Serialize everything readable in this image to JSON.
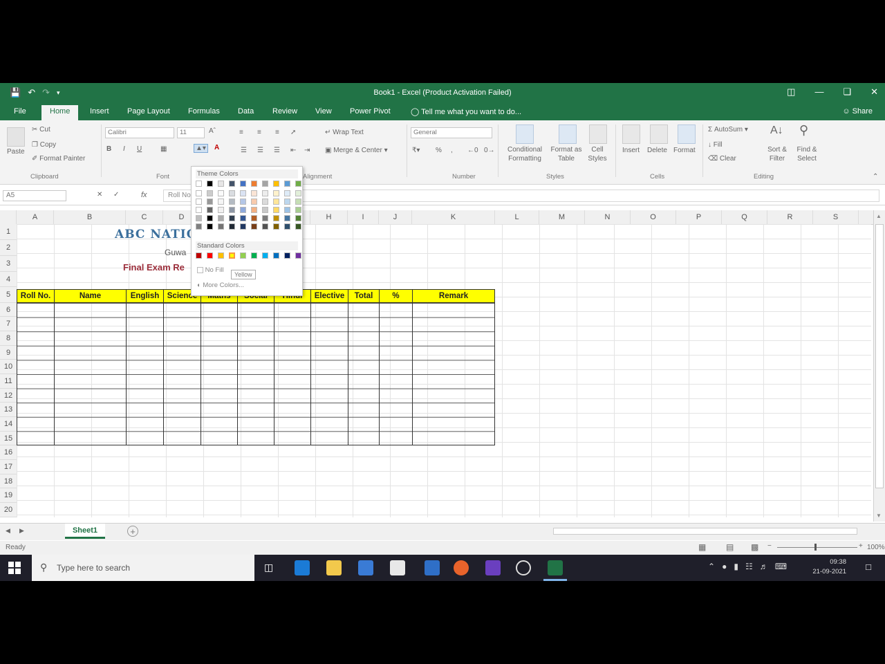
{
  "window": {
    "title": "Book1 - Excel (Product Activation Failed)",
    "share_label": "Share",
    "minimize_icon": "minimize-icon",
    "restore_icon": "restore-icon",
    "close_icon": "close-icon"
  },
  "ribbon_tabs": [
    "File",
    "Home",
    "Insert",
    "Page Layout",
    "Formulas",
    "Data",
    "Review",
    "View",
    "Power Pivot"
  ],
  "tell_me": "Tell me what you want to do...",
  "clipboard": {
    "paste": "Paste",
    "cut": "Cut",
    "copy": "Copy",
    "format_painter": "Format Painter",
    "label": "Clipboard"
  },
  "font": {
    "name": "Calibri",
    "size": "11",
    "label": "Font"
  },
  "alignment": {
    "wrap_text": "Wrap Text",
    "merge_center": "Merge & Center",
    "label": "Alignment"
  },
  "number": {
    "format": "General",
    "label": "Number"
  },
  "styles": {
    "conditional": "Conditional Formatting",
    "format_table": "Format as Table",
    "cell_styles": "Cell Styles",
    "label": "Styles"
  },
  "cells": {
    "insert": "Insert",
    "delete": "Delete",
    "format": "Format",
    "label": "Cells"
  },
  "editing": {
    "autosum": "AutoSum",
    "fill": "Fill",
    "clear": "Clear",
    "sort_filter": "Sort & Filter",
    "find_select": "Find & Select",
    "label": "Editing"
  },
  "formula_bar": {
    "name_box": "A5",
    "fx": "fx",
    "content": "Roll No."
  },
  "columns": [
    "A",
    "B",
    "C",
    "D",
    "E",
    "F",
    "G",
    "H",
    "I",
    "J",
    "K",
    "L",
    "M",
    "N",
    "O",
    "P",
    "Q",
    "R",
    "S"
  ],
  "rows": [
    "1",
    "2",
    "3",
    "4",
    "5",
    "6",
    "7",
    "8",
    "9",
    "10",
    "11",
    "12",
    "13",
    "14",
    "15",
    "16",
    "17",
    "18",
    "19",
    "20"
  ],
  "sheet_content": {
    "title": "ABC NATIO",
    "subtitle": "Guwa",
    "exam_title": "Final Exam Re"
  },
  "table_headers": [
    "Roll No.",
    "Name",
    "English",
    "Science",
    "Maths",
    "Social",
    "Hindi",
    "Elective",
    "Total",
    "%",
    "Remark"
  ],
  "color_menu": {
    "theme_label": "Theme Colors",
    "standard_label": "Standard Colors",
    "no_fill": "No Fill",
    "more_colors": "More Colors...",
    "tooltip": "Yellow",
    "theme_top": [
      "#ffffff",
      "#000000",
      "#e7e6e6",
      "#44546a",
      "#4472c4",
      "#ed7d31",
      "#a5a5a5",
      "#ffc000",
      "#5b9bd5",
      "#70ad47"
    ],
    "standard": [
      "#c00000",
      "#ff0000",
      "#ffc000",
      "#ffff00",
      "#92d050",
      "#00b050",
      "#00b0f0",
      "#0070c0",
      "#002060",
      "#7030a0"
    ]
  },
  "sheet_tab": "Sheet1",
  "status": {
    "ready": "Ready",
    "zoom": "100%"
  },
  "taskbar": {
    "search_placeholder": "Type here to search",
    "time": "09:38",
    "date": "21-09-2021"
  }
}
